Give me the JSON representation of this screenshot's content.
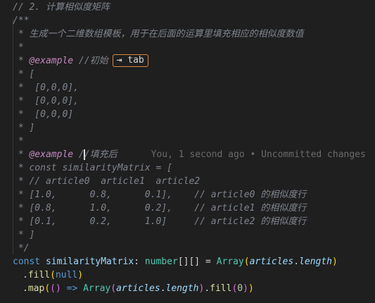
{
  "lines": {
    "l1": "// 2. 计算相似度矩阵",
    "l2": "/**",
    "l3": " * 生成一个二维数组模板，用于在后面的运算里填充相应的相似度数值",
    "l4": " *",
    "l5_prefix": " * ",
    "l5_tag": "@example",
    "l5_text": " //初始",
    "tab_hint": "⇥ tab",
    "l6": " * [",
    "l7": " *  [0,0,0],",
    "l8": " *  [0,0,0],",
    "l9": " *  [0,0,0]",
    "l10": " * ]",
    "l11": " *",
    "l12_prefix": " * ",
    "l12_tag": "@example",
    "l12_a": " /",
    "l12_b": "/填充后",
    "blame": "You, 1 second ago • Uncommitted changes",
    "l13": " * const similarityMatrix = [",
    "l14": " * // article0  article1  article2",
    "l15": " * [1.0,      0.8,      0.1],    // article0 的相似度行",
    "l16": " * [0.8,      1.0,      0.2],    // article1 的相似度行",
    "l17": " * [0.1,      0.2,      1.0]     // article2 的相似度行",
    "l18": " * ]",
    "l19": " */"
  },
  "code": {
    "const": "const",
    "name": "similarityMatrix",
    "colon": ":",
    "type": "number",
    "brackets": "[][]",
    "eq": " = ",
    "array": "Array",
    "articles": "articles",
    "dot": ".",
    "length": "length",
    "fill": "fill",
    "null": "null",
    "map": "map",
    "arrow": " => ",
    "zero": "0"
  }
}
